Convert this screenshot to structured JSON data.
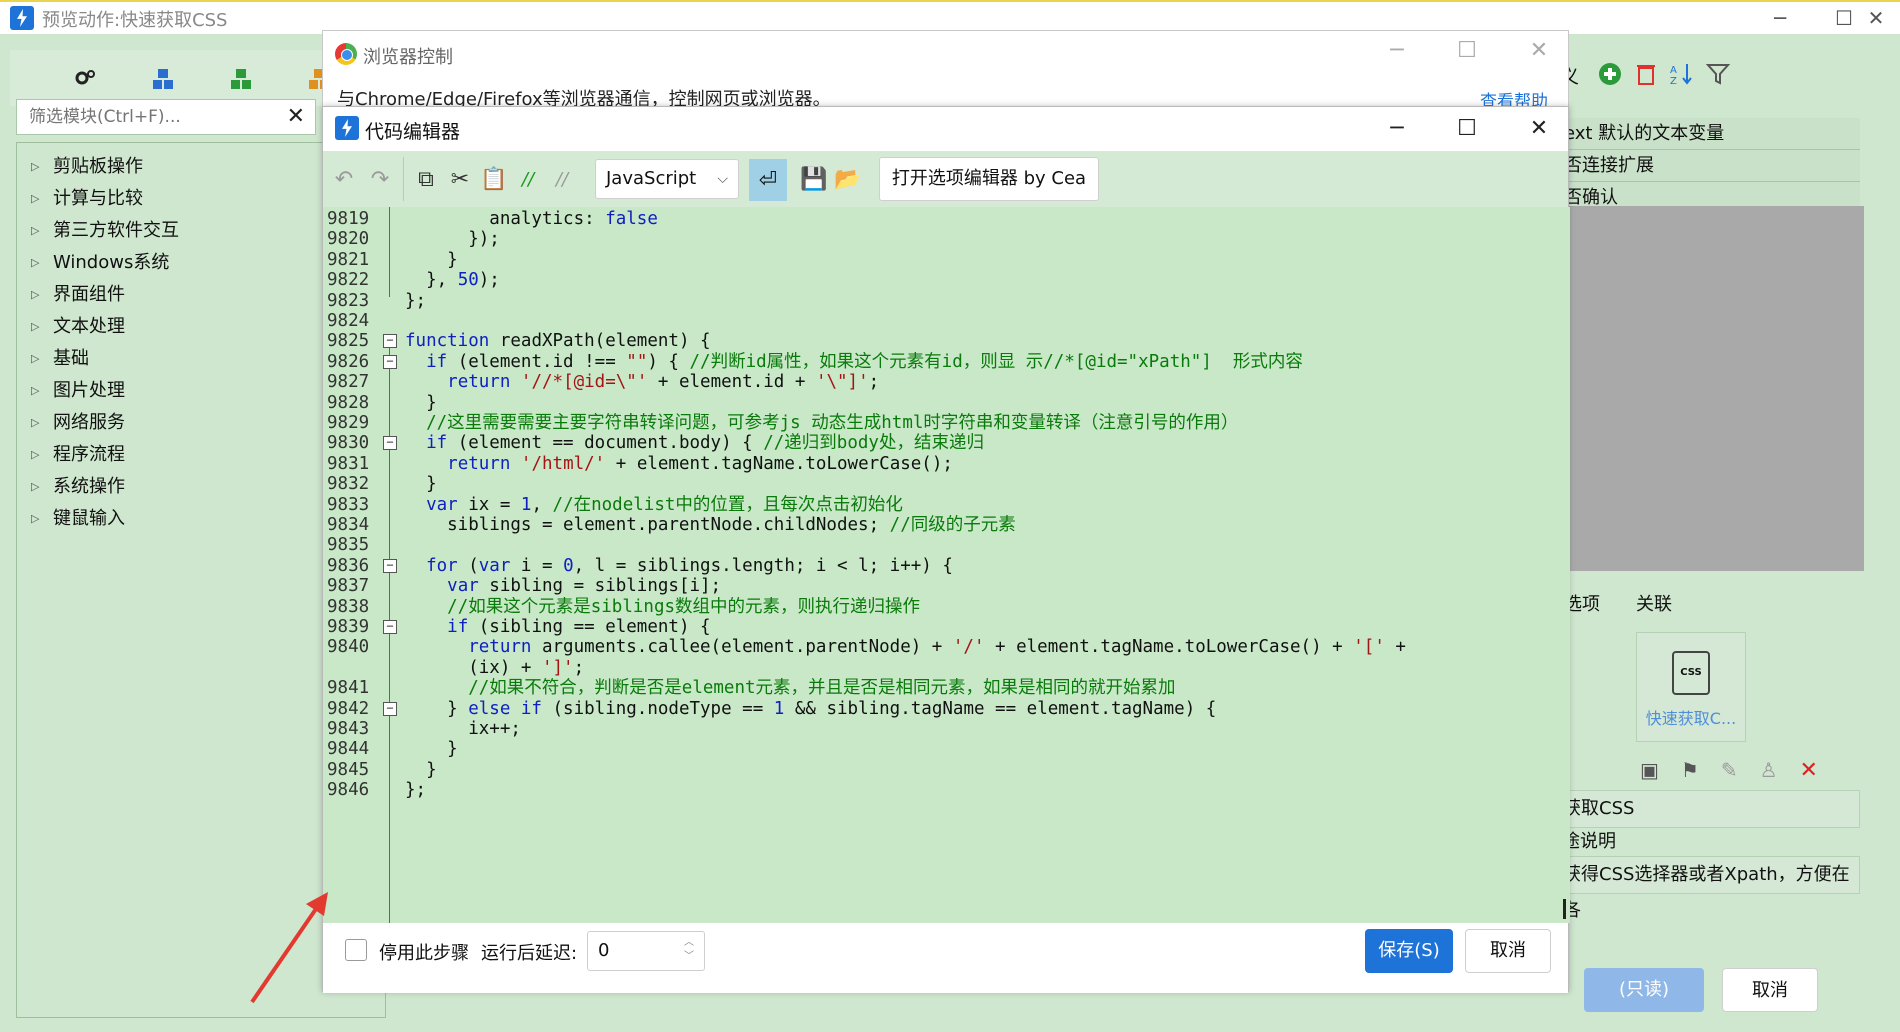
{
  "main_window": {
    "title": "预览动作:快速获取CSS"
  },
  "left_panel": {
    "search_placeholder": "筛选模块(Ctrl+F)...",
    "tree_items": [
      "剪贴板操作",
      "计算与比较",
      "第三方软件交互",
      "Windows系统",
      "界面组件",
      "文本处理",
      "基础",
      "图片处理",
      "网络服务",
      "程序流程",
      "系统操作",
      "键鼠输入"
    ]
  },
  "browser_window": {
    "title": "浏览器控制",
    "description": "与Chrome/Edge/Firefox等浏览器通信，控制网页或浏览器。",
    "help": "查看帮助"
  },
  "editor": {
    "title": "代码编辑器",
    "language": "JavaScript",
    "option_button": "打开选项编辑器 by Cea",
    "lines": [
      {
        "n": "9819",
        "html": "        analytics: <span class=\"kw\">false</span>"
      },
      {
        "n": "9820",
        "html": "      });"
      },
      {
        "n": "9821",
        "html": "    }"
      },
      {
        "n": "9822",
        "html": "  }, <span class=\"num\">50</span>);"
      },
      {
        "n": "9823",
        "html": "};"
      },
      {
        "n": "9824",
        "html": ""
      },
      {
        "n": "9825",
        "html": "<span class=\"kw\">function</span> readXPath(element) {",
        "fold": true
      },
      {
        "n": "9826",
        "html": "  <span class=\"kw\">if</span> (element.id !== <span class=\"str\">\"\"</span>) { <span class=\"cmt\">//判断id属性，如果这个元素有id，则显 示//*[@id=\"xPath\"]  形式内容</span>",
        "fold": true
      },
      {
        "n": "9827",
        "html": "    <span class=\"kw\">return</span> <span class=\"str\">'//*[@id=\\\"'</span> + element.id + <span class=\"str\">'\\\"]'</span>;"
      },
      {
        "n": "9828",
        "html": "  }"
      },
      {
        "n": "9829",
        "html": "  <span class=\"cmt\">//这里需要需要主要字符串转译问题，可参考js 动态生成html时字符串和变量转译（注意引号的作用）</span>"
      },
      {
        "n": "9830",
        "html": "  <span class=\"kw\">if</span> (element == document.body) { <span class=\"cmt\">//递归到body处，结束递归</span>",
        "fold": true
      },
      {
        "n": "9831",
        "html": "    <span class=\"kw\">return</span> <span class=\"str\">'/html/'</span> + element.tagName.toLowerCase();"
      },
      {
        "n": "9832",
        "html": "  }"
      },
      {
        "n": "9833",
        "html": "  <span class=\"kw\">var</span> ix = <span class=\"num\">1</span>, <span class=\"cmt\">//在nodelist中的位置，且每次点击初始化</span>"
      },
      {
        "n": "9834",
        "html": "    siblings = element.parentNode.childNodes; <span class=\"cmt\">//同级的子元素</span>"
      },
      {
        "n": "9835",
        "html": ""
      },
      {
        "n": "9836",
        "html": "  <span class=\"kw\">for</span> (<span class=\"kw\">var</span> i = <span class=\"num\">0</span>, l = siblings.length; i &lt; l; i++) {",
        "fold": true
      },
      {
        "n": "9837",
        "html": "    <span class=\"kw\">var</span> sibling = siblings[i];"
      },
      {
        "n": "9838",
        "html": "    <span class=\"cmt\">//如果这个元素是siblings数组中的元素，则执行递归操作</span>"
      },
      {
        "n": "9839",
        "html": "    <span class=\"kw\">if</span> (sibling == element) {",
        "fold": true
      },
      {
        "n": "9840",
        "html": "      <span class=\"kw\">return</span> arguments.callee(element.parentNode) + <span class=\"str\">'/'</span> + element.tagName.toLowerCase() + <span class=\"str\">'['</span> +"
      },
      {
        "n": "",
        "html": "      (ix) + <span class=\"str\">']'</span>;"
      },
      {
        "n": "9841",
        "html": "      <span class=\"cmt\">//如果不符合，判断是否是element元素，并且是否是相同元素，如果是相同的就开始累加</span>"
      },
      {
        "n": "9842",
        "html": "    } <span class=\"kw\">else if</span> (sibling.nodeType == <span class=\"num\">1</span> &amp;&amp; sibling.tagName == element.tagName) {",
        "fold": true
      },
      {
        "n": "9843",
        "html": "      ix++;"
      },
      {
        "n": "9844",
        "html": "    }"
      },
      {
        "n": "9845",
        "html": "  }"
      },
      {
        "n": "9846",
        "html": "};"
      }
    ],
    "footer": {
      "disable_label": "停用此步骤",
      "delay_label": "运行后延迟:",
      "delay_value": "0",
      "save_label": "保存(S)",
      "cancel_label": "取消"
    }
  },
  "right_panel": {
    "header_text": "义",
    "rows": [
      "ext 默认的文本变量",
      "否连接扩展",
      "否确认"
    ],
    "tabs": [
      "选项",
      "关联"
    ],
    "card_label": "快速获取C...",
    "card_icon_text": "CSS",
    "field_name": "获取CSS",
    "field_usage": "途说明",
    "field_desc": "获得CSS选择器或者Xpath，方便在各",
    "readonly_label": "(只读)",
    "cancel_label": "取消"
  }
}
